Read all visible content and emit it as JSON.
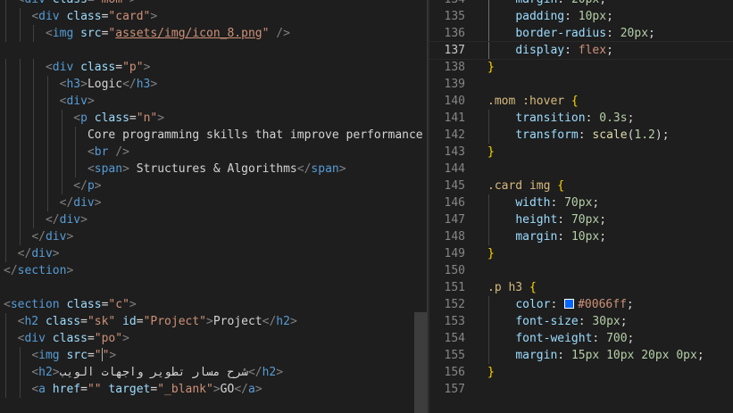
{
  "left_pane": {
    "lines": [
      {
        "indent": 1,
        "tokens": [
          [
            "punct",
            "<"
          ],
          [
            "tag",
            "div"
          ],
          [
            "attr",
            " class"
          ],
          [
            "plain",
            "="
          ],
          [
            "str",
            "\"mom\""
          ],
          [
            "punct",
            ">"
          ]
        ]
      },
      {
        "indent": 2,
        "tokens": [
          [
            "punct",
            "<"
          ],
          [
            "tag",
            "div"
          ],
          [
            "attr",
            " class"
          ],
          [
            "plain",
            "="
          ],
          [
            "str",
            "\"card\""
          ],
          [
            "punct",
            ">"
          ]
        ]
      },
      {
        "indent": 3,
        "tokens": [
          [
            "punct",
            "<"
          ],
          [
            "tag",
            "img"
          ],
          [
            "attr",
            " src"
          ],
          [
            "plain",
            "="
          ],
          [
            "str",
            "\""
          ],
          [
            "str-u",
            "assets/img/icon_8.png"
          ],
          [
            "str",
            "\""
          ],
          [
            "punct",
            " />"
          ]
        ]
      },
      {
        "indent": 0,
        "tokens": []
      },
      {
        "indent": 3,
        "tokens": [
          [
            "punct",
            "<"
          ],
          [
            "tag",
            "div"
          ],
          [
            "attr",
            " class"
          ],
          [
            "plain",
            "="
          ],
          [
            "str",
            "\"p\""
          ],
          [
            "punct",
            ">"
          ]
        ]
      },
      {
        "indent": 4,
        "tokens": [
          [
            "punct",
            "<"
          ],
          [
            "tag",
            "h3"
          ],
          [
            "punct",
            ">"
          ],
          [
            "text",
            "Logic"
          ],
          [
            "punct",
            "</"
          ],
          [
            "tag",
            "h3"
          ],
          [
            "punct",
            ">"
          ]
        ]
      },
      {
        "indent": 4,
        "tokens": [
          [
            "punct",
            "<"
          ],
          [
            "tag",
            "div"
          ],
          [
            "punct",
            ">"
          ]
        ]
      },
      {
        "indent": 5,
        "tokens": [
          [
            "punct",
            "<"
          ],
          [
            "tag",
            "p"
          ],
          [
            "attr",
            " class"
          ],
          [
            "plain",
            "="
          ],
          [
            "str",
            "\"n\""
          ],
          [
            "punct",
            ">"
          ]
        ]
      },
      {
        "indent": 6,
        "tokens": [
          [
            "text",
            "Core programming skills that improve performance a"
          ]
        ]
      },
      {
        "indent": 6,
        "tokens": [
          [
            "punct",
            "<"
          ],
          [
            "tag",
            "br"
          ],
          [
            "punct",
            " />"
          ]
        ]
      },
      {
        "indent": 6,
        "tokens": [
          [
            "punct",
            "<"
          ],
          [
            "tag",
            "span"
          ],
          [
            "punct",
            ">"
          ],
          [
            "text",
            " Structures & Algorithms"
          ],
          [
            "punct",
            "</"
          ],
          [
            "tag",
            "span"
          ],
          [
            "punct",
            ">"
          ]
        ]
      },
      {
        "indent": 5,
        "tokens": [
          [
            "punct",
            "</"
          ],
          [
            "tag",
            "p"
          ],
          [
            "punct",
            ">"
          ]
        ]
      },
      {
        "indent": 4,
        "tokens": [
          [
            "punct",
            "</"
          ],
          [
            "tag",
            "div"
          ],
          [
            "punct",
            ">"
          ]
        ]
      },
      {
        "indent": 3,
        "tokens": [
          [
            "punct",
            "</"
          ],
          [
            "tag",
            "div"
          ],
          [
            "punct",
            ">"
          ]
        ]
      },
      {
        "indent": 2,
        "tokens": [
          [
            "punct",
            "</"
          ],
          [
            "tag",
            "div"
          ],
          [
            "punct",
            ">"
          ]
        ]
      },
      {
        "indent": 1,
        "tokens": [
          [
            "punct",
            "</"
          ],
          [
            "tag",
            "div"
          ],
          [
            "punct",
            ">"
          ]
        ]
      },
      {
        "indent": 0,
        "tokens": [
          [
            "punct",
            "</"
          ],
          [
            "tag",
            "section"
          ],
          [
            "punct",
            ">"
          ]
        ]
      },
      {
        "indent": 0,
        "tokens": []
      },
      {
        "indent": 0,
        "tokens": [
          [
            "punct",
            "<"
          ],
          [
            "tag",
            "section"
          ],
          [
            "attr",
            " class"
          ],
          [
            "plain",
            "="
          ],
          [
            "str",
            "\"c\""
          ],
          [
            "punct",
            ">"
          ]
        ]
      },
      {
        "indent": 1,
        "tokens": [
          [
            "punct",
            "<"
          ],
          [
            "tag",
            "h2"
          ],
          [
            "attr",
            " class"
          ],
          [
            "plain",
            "="
          ],
          [
            "str",
            "\"sk\""
          ],
          [
            "attr",
            " id"
          ],
          [
            "plain",
            "="
          ],
          [
            "str",
            "\"Project\""
          ],
          [
            "punct",
            ">"
          ],
          [
            "text",
            "Project"
          ],
          [
            "punct",
            "</"
          ],
          [
            "tag",
            "h2"
          ],
          [
            "punct",
            ">"
          ]
        ]
      },
      {
        "indent": 1,
        "tokens": [
          [
            "punct",
            "<"
          ],
          [
            "tag",
            "div"
          ],
          [
            "attr",
            " class"
          ],
          [
            "plain",
            "="
          ],
          [
            "str",
            "\"po\""
          ],
          [
            "punct",
            ">"
          ]
        ]
      },
      {
        "indent": 2,
        "tokens": [
          [
            "punct",
            "<"
          ],
          [
            "tag",
            "img"
          ],
          [
            "attr",
            " src"
          ],
          [
            "plain",
            "="
          ],
          [
            "str",
            "\""
          ],
          [
            "cursor",
            ""
          ],
          [
            "str",
            "\""
          ],
          [
            "punct",
            ">"
          ]
        ]
      },
      {
        "indent": 2,
        "tokens": [
          [
            "punct",
            "<"
          ],
          [
            "tag",
            "h2"
          ],
          [
            "punct",
            ">"
          ],
          [
            "text",
            "شرح مسار تطوير واجهات الويب"
          ],
          [
            "punct",
            "</"
          ],
          [
            "tag",
            "h2"
          ],
          [
            "punct",
            ">"
          ]
        ]
      },
      {
        "indent": 2,
        "tokens": [
          [
            "punct",
            "<"
          ],
          [
            "tag",
            "a"
          ],
          [
            "attr",
            " href"
          ],
          [
            "plain",
            "="
          ],
          [
            "str",
            "\"\""
          ],
          [
            "attr",
            " target"
          ],
          [
            "plain",
            "="
          ],
          [
            "str",
            "\"_blank\""
          ],
          [
            "punct",
            ">"
          ],
          [
            "text",
            "GO"
          ],
          [
            "punct",
            "</"
          ],
          [
            "tag",
            "a"
          ],
          [
            "punct",
            ">"
          ]
        ]
      }
    ]
  },
  "right_pane": {
    "active_line": "137",
    "lines": [
      {
        "num": "134",
        "indent": 1,
        "tokens": [
          [
            "prop",
            "margin"
          ],
          [
            "plain",
            ": "
          ],
          [
            "num",
            "20px"
          ],
          [
            "plain",
            ";"
          ]
        ]
      },
      {
        "num": "135",
        "indent": 1,
        "tokens": [
          [
            "prop",
            "padding"
          ],
          [
            "plain",
            ": "
          ],
          [
            "num",
            "10px"
          ],
          [
            "plain",
            ";"
          ]
        ]
      },
      {
        "num": "136",
        "indent": 1,
        "tokens": [
          [
            "prop",
            "border-radius"
          ],
          [
            "plain",
            ": "
          ],
          [
            "num",
            "20px"
          ],
          [
            "plain",
            ";"
          ]
        ]
      },
      {
        "num": "137",
        "indent": 1,
        "tokens": [
          [
            "prop",
            "display"
          ],
          [
            "plain",
            ": "
          ],
          [
            "val",
            "flex"
          ],
          [
            "plain",
            ";"
          ]
        ]
      },
      {
        "num": "138",
        "indent": 0,
        "tokens": [
          [
            "brace",
            "}"
          ]
        ]
      },
      {
        "num": "139",
        "indent": 0,
        "tokens": []
      },
      {
        "num": "140",
        "indent": 0,
        "tokens": [
          [
            "sel",
            ".mom :hover "
          ],
          [
            "brace",
            "{"
          ]
        ]
      },
      {
        "num": "141",
        "indent": 1,
        "tokens": [
          [
            "prop",
            "transition"
          ],
          [
            "plain",
            ": "
          ],
          [
            "num",
            "0.3s"
          ],
          [
            "plain",
            ";"
          ]
        ]
      },
      {
        "num": "142",
        "indent": 1,
        "tokens": [
          [
            "prop",
            "transform"
          ],
          [
            "plain",
            ": "
          ],
          [
            "fn",
            "scale"
          ],
          [
            "plain",
            "("
          ],
          [
            "num",
            "1.2"
          ],
          [
            "plain",
            ");"
          ]
        ]
      },
      {
        "num": "143",
        "indent": 0,
        "tokens": [
          [
            "brace",
            "}"
          ]
        ]
      },
      {
        "num": "144",
        "indent": 0,
        "tokens": []
      },
      {
        "num": "145",
        "indent": 0,
        "tokens": [
          [
            "sel",
            ".card img "
          ],
          [
            "brace",
            "{"
          ]
        ]
      },
      {
        "num": "146",
        "indent": 1,
        "tokens": [
          [
            "prop",
            "width"
          ],
          [
            "plain",
            ": "
          ],
          [
            "num",
            "70px"
          ],
          [
            "plain",
            ";"
          ]
        ]
      },
      {
        "num": "147",
        "indent": 1,
        "tokens": [
          [
            "prop",
            "height"
          ],
          [
            "plain",
            ": "
          ],
          [
            "num",
            "70px"
          ],
          [
            "plain",
            ";"
          ]
        ]
      },
      {
        "num": "148",
        "indent": 1,
        "tokens": [
          [
            "prop",
            "margin"
          ],
          [
            "plain",
            ": "
          ],
          [
            "num",
            "10px"
          ],
          [
            "plain",
            ";"
          ]
        ]
      },
      {
        "num": "149",
        "indent": 0,
        "tokens": [
          [
            "brace",
            "}"
          ]
        ]
      },
      {
        "num": "150",
        "indent": 0,
        "tokens": []
      },
      {
        "num": "151",
        "indent": 0,
        "tokens": [
          [
            "sel",
            ".p h3 "
          ],
          [
            "brace",
            "{"
          ]
        ]
      },
      {
        "num": "152",
        "indent": 1,
        "tokens": [
          [
            "prop",
            "color"
          ],
          [
            "plain",
            ": "
          ],
          [
            "swatch",
            "#0066ff"
          ],
          [
            "val",
            "#0066ff"
          ],
          [
            "plain",
            ";"
          ]
        ]
      },
      {
        "num": "153",
        "indent": 1,
        "tokens": [
          [
            "prop",
            "font-size"
          ],
          [
            "plain",
            ": "
          ],
          [
            "num",
            "30px"
          ],
          [
            "plain",
            ";"
          ]
        ]
      },
      {
        "num": "154",
        "indent": 1,
        "tokens": [
          [
            "prop",
            "font-weight"
          ],
          [
            "plain",
            ": "
          ],
          [
            "num",
            "700"
          ],
          [
            "plain",
            ";"
          ]
        ]
      },
      {
        "num": "155",
        "indent": 1,
        "tokens": [
          [
            "prop",
            "margin"
          ],
          [
            "plain",
            ": "
          ],
          [
            "num",
            "15px 10px 20px 0px"
          ],
          [
            "plain",
            ";"
          ]
        ]
      },
      {
        "num": "156",
        "indent": 0,
        "tokens": [
          [
            "brace",
            "}"
          ]
        ]
      },
      {
        "num": "157",
        "indent": 0,
        "tokens": []
      }
    ]
  }
}
